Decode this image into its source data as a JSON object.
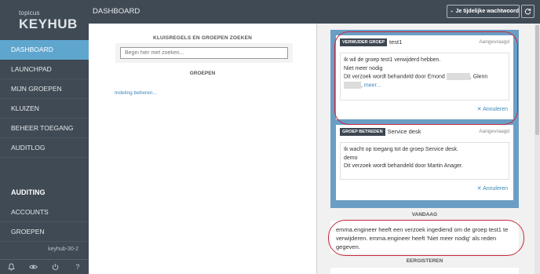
{
  "logo": {
    "sub": "topicus",
    "main": "KEYHUB"
  },
  "sidebar": {
    "items": [
      {
        "label": "DASHBOARD",
        "active": true
      },
      {
        "label": "LAUNCHPAD"
      },
      {
        "label": "MIJN GROEPEN"
      },
      {
        "label": "KLUIZEN"
      },
      {
        "label": "BEHEER TOEGANG"
      },
      {
        "label": "AUDITLOG"
      }
    ],
    "section_title": "AUDITING",
    "section_items": [
      {
        "label": "ACCOUNTS"
      },
      {
        "label": "GROEPEN"
      }
    ],
    "version": "keyhub-30-2",
    "footer_icons": [
      "bell-icon",
      "eye-icon",
      "power-icon",
      "help-icon"
    ]
  },
  "header": {
    "title": "DASHBOARD",
    "password_button": "Je tijdelijke wachtwoord"
  },
  "search": {
    "title": "KLUISREGELS EN GROEPEN ZOEKEN",
    "placeholder": "Begin hier met zoeken...",
    "groups_title": "GROEPEN",
    "manage_link": "Indeling beheren..."
  },
  "requests": [
    {
      "tag": "VERWIJDER GROEP",
      "name": "test1",
      "status": "Aangevraagd",
      "line1": "Ik wil de groep test1 verwijderd hebben.",
      "line2": "Niet meer nodig",
      "line3": "Dit verzoek wordt behandeld door Emond",
      "line3b": ", Glenn",
      "line4_sep": ",",
      "more": "meer...",
      "cancel": "Annuleren"
    },
    {
      "tag": "GROEP BETREDEN",
      "name": "Service desk",
      "status": "Aangevraagd",
      "line1": "Ik wacht op toegang tot de groep Service desk.",
      "line2": "demo",
      "line3": "Dit verzoek wordt behandeld door Martin Anager.",
      "cancel": "Annuleren"
    }
  ],
  "today": {
    "title": "VANDAAG",
    "text": "emma.engineer heeft een verzoek ingediend om de groep test1 te verwijderen. emma.engineer heeft 'Niet meer nodig' als reden gegeven."
  },
  "yesterday": {
    "title": "EERGISTEREN"
  },
  "colors": {
    "sidebar": "#404a54",
    "active": "#5fa6cf",
    "panel": "#6a9ec5",
    "annotation": "#c8283c"
  }
}
